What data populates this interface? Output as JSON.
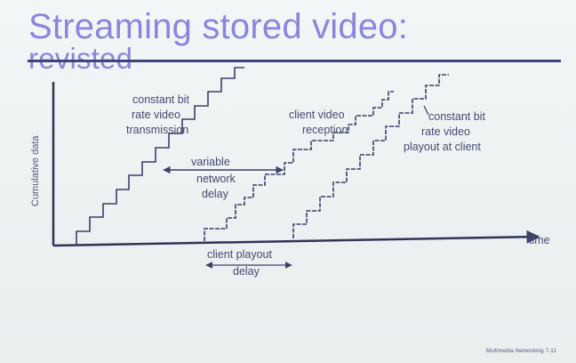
{
  "slide": {
    "title_line_1": "Streaming stored video:",
    "title_line_2": "revisted",
    "footer": "Multimedia Networking 7-11",
    "colors": {
      "title": "#8a86dd",
      "ink": "#45496f",
      "axis": "#2f3357",
      "strike": "#40447a"
    }
  },
  "diagram": {
    "y_axis_label": "Cumulative data",
    "x_axis_label": "time",
    "label_transmission": [
      "constant bit",
      "rate video",
      "transmission"
    ],
    "label_network_delay": [
      "variable",
      "network",
      "delay"
    ],
    "label_reception": [
      "client video",
      "reception"
    ],
    "label_playout": [
      "constant bit",
      "rate video",
      "playout at client"
    ],
    "label_playout_delay": [
      "client playout",
      "delay"
    ]
  }
}
